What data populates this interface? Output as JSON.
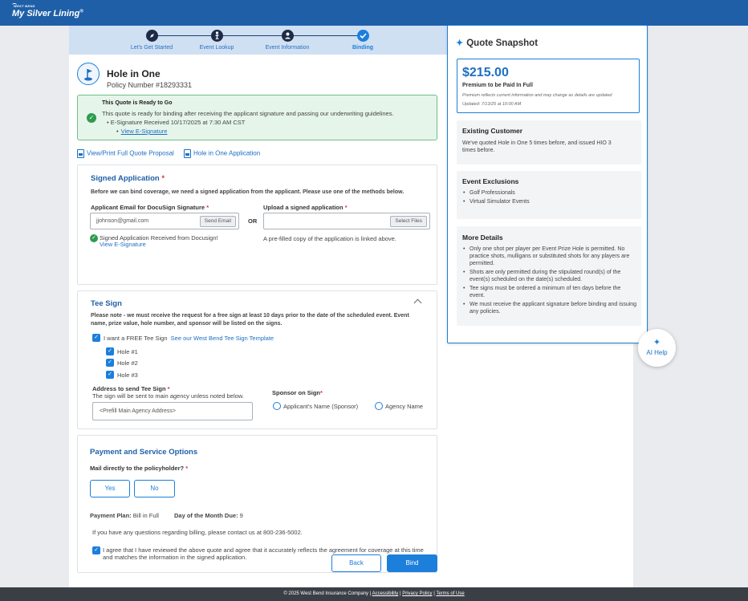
{
  "brand": {
    "small": "WEST BEND",
    "name": "My Silver Lining",
    "mark": "®"
  },
  "stepper": {
    "steps": [
      {
        "label": "Let's Get Started",
        "icon": "compass-icon"
      },
      {
        "label": "Event Lookup",
        "icon": "golfer-icon"
      },
      {
        "label": "Event Information",
        "icon": "person-icon"
      },
      {
        "label": "Binding",
        "icon": "check-icon"
      }
    ],
    "active_index": 3
  },
  "policy": {
    "title": "Hole in One",
    "number": "Policy Number #18293331",
    "icon": "golf-flag-icon"
  },
  "alert": {
    "title": "This Quote is Ready to Go",
    "text": "This quote is ready for binding after receiving the applicant signature and passing our underwriting guidelines.",
    "bullet1": "E-Signature Received 10/17/2025 at 7:30 AM CST",
    "bullet2": "View E-Signature"
  },
  "links": {
    "proposal": "View/Print Full Quote Proposal",
    "application": "Hole in One Application"
  },
  "signed_application": {
    "title": "Signed Application",
    "required_mark": "*",
    "instructions": "Before we can bind coverage, we need a signed application from the applicant. Please use one of the methods below.",
    "email_label": "Applicant Email for DocuSign Signature",
    "email_value": "jjohnson@gmail.com",
    "send_email": "Send Email",
    "or": "OR",
    "upload_label": "Upload a signed application",
    "select_files": "Select Files",
    "received": "Signed Application Received from Docusign!",
    "view_esig": "View E-Signature",
    "prefilled_note": "A pre-filled copy of the application is linked above."
  },
  "tee_sign": {
    "title": "Tee Sign",
    "note": "Please note - we must receive the request for a free sign at least 10 days prior to the date of the scheduled event. Event name, prize value, hole number, and sponsor will be listed on the signs.",
    "free_sign_label": "I want a FREE Tee Sign",
    "template_link": "See our West Bend Tee Sign Template",
    "holes": [
      "Hole #1",
      "Hole #2",
      "Hole #3"
    ],
    "address_label": "Address to send Tee Sign",
    "address_sub": "The sign will be sent to main agency unless noted below.",
    "address_value": "<Prefill Main Agency Address>",
    "sponsor_label": "Sponsor on Sign",
    "sponsor_options": [
      "Applicant's Name (Sponsor)",
      "Agency Name"
    ]
  },
  "payment": {
    "title": "Payment and Service Options",
    "mail_label": "Mail directly to the policyholder?",
    "yes": "Yes",
    "no": "No",
    "plan_label": "Payment Plan:",
    "plan_value": "Bill in Full",
    "due_label": "Day of the Month Due:",
    "due_value": "9",
    "billing_note": "If you have any questions regarding billing, please contact us at 800-236-5002.",
    "agree": "I agree that I have reviewed the above quote and agree that it accurately reflects the agreement for coverage at this time and matches the information in the signed application."
  },
  "actions": {
    "back": "Back",
    "bind": "Bind"
  },
  "snapshot": {
    "title": "Quote Snapshot",
    "price": "$215.00",
    "price_sub": "Premium to be Paid In Full",
    "price_note": "Premium reflects current information and may change as details are updated",
    "updated": "Updated: 7/13/25 at 10:00 AM",
    "existing_title": "Existing Customer",
    "existing_text": "We've quoted Hole in One 5 times before, and issued HIO 3 times before.",
    "exclusions_title": "Event Exclusions",
    "exclusions": [
      "Golf Professionals",
      "Virtual Simulator Events"
    ],
    "details_title": "More Details",
    "details": [
      "Only one shot per player per Event Prize Hole is permitted. No practice shots, mulligans or substituted shots for any players are permitted.",
      "Shots are only permitted during the stipulated round(s) of the event(s) scheduled on the date(s) scheduled.",
      "Tee signs must be ordered a minimum of ten days before the event.",
      "We must receive the applicant signature before binding and issuing any policies."
    ]
  },
  "ai_help": "AI Help",
  "footer": {
    "copyright": "© 2025 West Bend Insurance Company |",
    "accessibility": "Accessibility",
    "privacy": "Privacy Policy",
    "terms": "Terms of Use",
    "sep": "|"
  },
  "colors": {
    "brand": "#1f5fa8",
    "accent": "#1c7fdb",
    "success": "#2e9b4f",
    "required": "#d9363e"
  }
}
